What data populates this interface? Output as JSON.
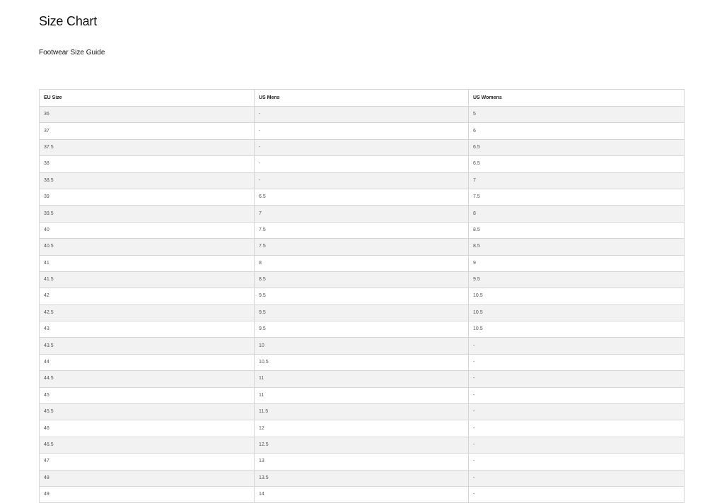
{
  "page": {
    "title": "Size Chart",
    "subtitle": "Footwear Size Guide"
  },
  "table": {
    "headers": [
      "EU Size",
      "US Mens",
      "US Womens"
    ],
    "rows": [
      [
        "36",
        "-",
        "5"
      ],
      [
        "37",
        "-",
        "6"
      ],
      [
        "37.5",
        "-",
        "6.5"
      ],
      [
        "38",
        "-",
        "6.5"
      ],
      [
        "38.5",
        "-",
        "7"
      ],
      [
        "39",
        "6.5",
        "7.5"
      ],
      [
        "39.5",
        "7",
        "8"
      ],
      [
        "40",
        "7.5",
        "8.5"
      ],
      [
        "40.5",
        "7.5",
        "8.5"
      ],
      [
        "41",
        "8",
        "9"
      ],
      [
        "41.5",
        "8.5",
        "9.5"
      ],
      [
        "42",
        "9.5",
        "10.5"
      ],
      [
        "42.5",
        "9.5",
        "10.5"
      ],
      [
        "43",
        "9.5",
        "10.5"
      ],
      [
        "43.5",
        "10",
        "-"
      ],
      [
        "44",
        "10.5",
        "-"
      ],
      [
        "44.5",
        "11",
        "-"
      ],
      [
        "45",
        "11",
        "-"
      ],
      [
        "45.5",
        "11.5",
        "-"
      ],
      [
        "46",
        "12",
        "-"
      ],
      [
        "46.5",
        "12.5",
        "-"
      ],
      [
        "47",
        "13",
        "-"
      ],
      [
        "48",
        "13.5",
        "-"
      ],
      [
        "49",
        "14",
        "-"
      ]
    ]
  }
}
